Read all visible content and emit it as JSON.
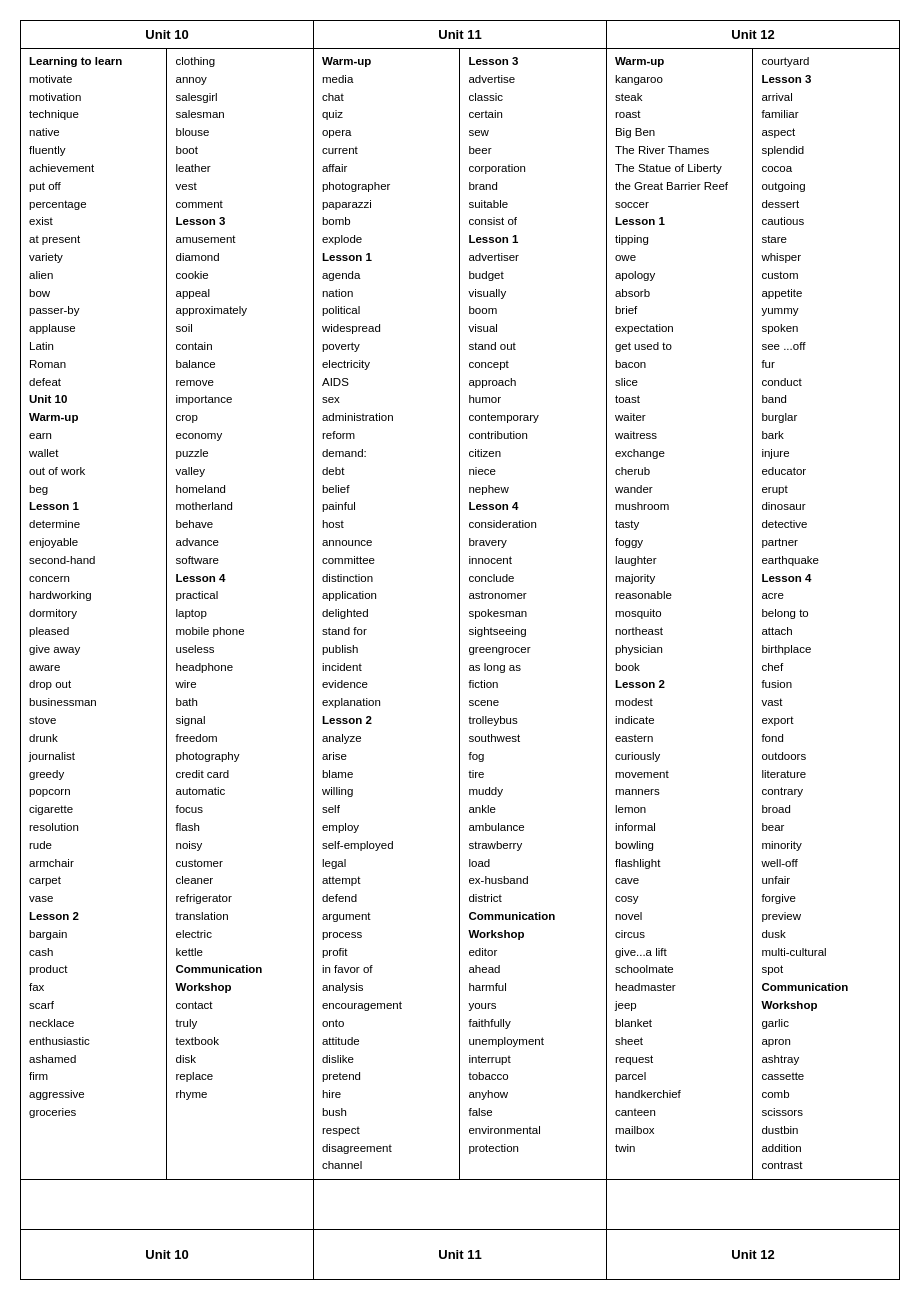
{
  "units": {
    "unit10_header": "Unit 10",
    "unit11_header": "Unit 11",
    "unit12_header": "Unit 12"
  },
  "columns": {
    "col1": [
      {
        "text": "Learning to learn",
        "bold": true
      },
      {
        "text": "motivate"
      },
      {
        "text": "motivation"
      },
      {
        "text": "technique"
      },
      {
        "text": "native"
      },
      {
        "text": "fluently"
      },
      {
        "text": "achievement"
      },
      {
        "text": "put off"
      },
      {
        "text": "percentage"
      },
      {
        "text": "exist"
      },
      {
        "text": "at present"
      },
      {
        "text": "variety"
      },
      {
        "text": "alien"
      },
      {
        "text": "bow"
      },
      {
        "text": "passer-by"
      },
      {
        "text": "applause"
      },
      {
        "text": "Latin"
      },
      {
        "text": "Roman"
      },
      {
        "text": "defeat"
      },
      {
        "text": "Unit 10",
        "bold": true
      },
      {
        "text": "Warm-up",
        "bold": true
      },
      {
        "text": "earn"
      },
      {
        "text": "wallet"
      },
      {
        "text": "out of work"
      },
      {
        "text": "beg"
      },
      {
        "text": "Lesson 1",
        "bold": true
      },
      {
        "text": "determine"
      },
      {
        "text": "enjoyable"
      },
      {
        "text": "second-hand"
      },
      {
        "text": "concern"
      },
      {
        "text": "hardworking"
      },
      {
        "text": "dormitory"
      },
      {
        "text": "pleased"
      },
      {
        "text": "give away"
      },
      {
        "text": "aware"
      },
      {
        "text": "drop out"
      },
      {
        "text": "businessman"
      },
      {
        "text": " stove"
      },
      {
        "text": "drunk"
      },
      {
        "text": "journalist"
      },
      {
        "text": "greedy"
      },
      {
        "text": "popcorn"
      },
      {
        "text": "cigarette"
      },
      {
        "text": "resolution"
      },
      {
        "text": "rude"
      },
      {
        "text": "armchair"
      },
      {
        "text": "carpet"
      },
      {
        "text": "vase"
      },
      {
        "text": "Lesson 2",
        "bold": true
      },
      {
        "text": "bargain"
      },
      {
        "text": "cash"
      },
      {
        "text": "product"
      },
      {
        "text": "fax"
      },
      {
        "text": "scarf"
      },
      {
        "text": "necklace"
      },
      {
        "text": "enthusiastic"
      },
      {
        "text": "ashamed"
      },
      {
        "text": "firm"
      },
      {
        "text": "aggressive"
      },
      {
        "text": "groceries"
      }
    ],
    "col2": [
      {
        "text": "clothing"
      },
      {
        "text": "annoy"
      },
      {
        "text": "salesgirl"
      },
      {
        "text": "salesman"
      },
      {
        "text": "blouse"
      },
      {
        "text": "boot"
      },
      {
        "text": "leather"
      },
      {
        "text": "vest"
      },
      {
        "text": "comment"
      },
      {
        "text": "Lesson 3",
        "bold": true
      },
      {
        "text": "amusement"
      },
      {
        "text": "diamond"
      },
      {
        "text": "cookie"
      },
      {
        "text": "appeal"
      },
      {
        "text": "approximately"
      },
      {
        "text": "soil"
      },
      {
        "text": "contain"
      },
      {
        "text": "balance"
      },
      {
        "text": "remove"
      },
      {
        "text": "importance"
      },
      {
        "text": "crop"
      },
      {
        "text": "economy"
      },
      {
        "text": "puzzle"
      },
      {
        "text": "valley"
      },
      {
        "text": "homeland"
      },
      {
        "text": "motherland"
      },
      {
        "text": "behave"
      },
      {
        "text": "advance"
      },
      {
        "text": "software"
      },
      {
        "text": "Lesson 4",
        "bold": true
      },
      {
        "text": "practical"
      },
      {
        "text": "laptop"
      },
      {
        "text": "mobile phone"
      },
      {
        "text": "useless"
      },
      {
        "text": "headphone"
      },
      {
        "text": "wire"
      },
      {
        "text": "bath"
      },
      {
        "text": "signal"
      },
      {
        "text": "freedom"
      },
      {
        "text": "photography"
      },
      {
        "text": "credit card"
      },
      {
        "text": "automatic"
      },
      {
        "text": "focus"
      },
      {
        "text": "flash"
      },
      {
        "text": "noisy"
      },
      {
        "text": "customer"
      },
      {
        "text": "cleaner"
      },
      {
        "text": "refrigerator"
      },
      {
        "text": "translation"
      },
      {
        "text": "electric"
      },
      {
        "text": "kettle"
      },
      {
        "text": "Communication",
        "bold": true
      },
      {
        "text": "Workshop",
        "bold": true
      },
      {
        "text": "contact"
      },
      {
        "text": "truly"
      },
      {
        "text": "textbook"
      },
      {
        "text": "disk"
      },
      {
        "text": "replace"
      },
      {
        "text": "rhyme"
      }
    ],
    "col3": [
      {
        "text": "Warm-up",
        "bold": true
      },
      {
        "text": "media"
      },
      {
        "text": "chat"
      },
      {
        "text": "quiz"
      },
      {
        "text": "opera"
      },
      {
        "text": "current"
      },
      {
        "text": "affair"
      },
      {
        "text": "photographer"
      },
      {
        "text": "paparazzi"
      },
      {
        "text": "bomb"
      },
      {
        "text": "explode"
      },
      {
        "text": "Lesson 1",
        "bold": true
      },
      {
        "text": "agenda"
      },
      {
        "text": "nation"
      },
      {
        "text": "political"
      },
      {
        "text": "widespread"
      },
      {
        "text": "poverty"
      },
      {
        "text": "electricity"
      },
      {
        "text": "AIDS"
      },
      {
        "text": "sex"
      },
      {
        "text": "administration"
      },
      {
        "text": "reform"
      },
      {
        "text": "demand:"
      },
      {
        "text": "debt"
      },
      {
        "text": "belief"
      },
      {
        "text": "painful"
      },
      {
        "text": "host"
      },
      {
        "text": "announce"
      },
      {
        "text": "committee"
      },
      {
        "text": "distinction"
      },
      {
        "text": "application"
      },
      {
        "text": "delighted"
      },
      {
        "text": "stand for"
      },
      {
        "text": "publish"
      },
      {
        "text": "incident"
      },
      {
        "text": "evidence"
      },
      {
        "text": "explanation"
      },
      {
        "text": "Lesson 2",
        "bold": true
      },
      {
        "text": "analyze"
      },
      {
        "text": "arise"
      },
      {
        "text": "blame"
      },
      {
        "text": "willing"
      },
      {
        "text": "self"
      },
      {
        "text": "employ"
      },
      {
        "text": "self-employed"
      },
      {
        "text": "legal"
      },
      {
        "text": "attempt"
      },
      {
        "text": "defend"
      },
      {
        "text": "argument"
      },
      {
        "text": "process"
      },
      {
        "text": "profit"
      },
      {
        "text": "in favor of"
      },
      {
        "text": "analysis"
      },
      {
        "text": "encouragement"
      },
      {
        "text": "onto"
      },
      {
        "text": "attitude"
      },
      {
        "text": "dislike"
      },
      {
        "text": "pretend"
      },
      {
        "text": "hire"
      },
      {
        "text": "bush"
      },
      {
        "text": "respect"
      },
      {
        "text": "disagreement"
      },
      {
        "text": "channel"
      }
    ],
    "col4": [
      {
        "text": "Lesson 3",
        "bold": true
      },
      {
        "text": "advertise"
      },
      {
        "text": "classic"
      },
      {
        "text": "certain"
      },
      {
        "text": "sew"
      },
      {
        "text": "beer"
      },
      {
        "text": "corporation"
      },
      {
        "text": "brand"
      },
      {
        "text": "suitable"
      },
      {
        "text": "consist of"
      },
      {
        "text": "Lesson 1",
        "bold": true
      },
      {
        "text": "advertiser"
      },
      {
        "text": "budget"
      },
      {
        "text": "visually"
      },
      {
        "text": "boom"
      },
      {
        "text": "visual"
      },
      {
        "text": "stand out"
      },
      {
        "text": "concept"
      },
      {
        "text": "approach"
      },
      {
        "text": "humor"
      },
      {
        "text": "contemporary"
      },
      {
        "text": "contribution"
      },
      {
        "text": "citizen"
      },
      {
        "text": "niece"
      },
      {
        "text": "nephew"
      },
      {
        "text": "Lesson 4",
        "bold": true
      },
      {
        "text": "consideration"
      },
      {
        "text": "bravery"
      },
      {
        "text": "innocent"
      },
      {
        "text": "conclude"
      },
      {
        "text": "astronomer"
      },
      {
        "text": "spokesman"
      },
      {
        "text": "sightseeing"
      },
      {
        "text": "greengrocer"
      },
      {
        "text": "as long as"
      },
      {
        "text": "fiction"
      },
      {
        "text": "scene"
      },
      {
        "text": "trolleybus"
      },
      {
        "text": "southwest"
      },
      {
        "text": "fog"
      },
      {
        "text": "tire"
      },
      {
        "text": "muddy"
      },
      {
        "text": "ankle"
      },
      {
        "text": "ambulance"
      },
      {
        "text": "strawberry"
      },
      {
        "text": "load"
      },
      {
        "text": "ex-husband"
      },
      {
        "text": "district"
      },
      {
        "text": "Communication",
        "bold": true
      },
      {
        "text": "Workshop",
        "bold": true
      },
      {
        "text": "editor"
      },
      {
        "text": "ahead"
      },
      {
        "text": "harmful"
      },
      {
        "text": "yours"
      },
      {
        "text": "faithfully"
      },
      {
        "text": "unemployment"
      },
      {
        "text": "interrupt"
      },
      {
        "text": "tobacco"
      },
      {
        "text": "anyhow"
      },
      {
        "text": "false"
      },
      {
        "text": "environmental"
      },
      {
        "text": "protection"
      }
    ],
    "col5": [
      {
        "text": "Warm-up",
        "bold": true
      },
      {
        "text": "kangaroo"
      },
      {
        "text": "steak"
      },
      {
        "text": "roast"
      },
      {
        "text": "Big Ben"
      },
      {
        "text": "The River Thames"
      },
      {
        "text": "The Statue of Liberty"
      },
      {
        "text": "the Great Barrier Reef"
      },
      {
        "text": "soccer"
      },
      {
        "text": "Lesson 1",
        "bold": true
      },
      {
        "text": "tipping"
      },
      {
        "text": "owe"
      },
      {
        "text": "apology"
      },
      {
        "text": "absorb"
      },
      {
        "text": "brief"
      },
      {
        "text": "expectation"
      },
      {
        "text": "get used to"
      },
      {
        "text": "bacon"
      },
      {
        "text": "slice"
      },
      {
        "text": "toast"
      },
      {
        "text": "waiter"
      },
      {
        "text": "waitress"
      },
      {
        "text": "exchange"
      },
      {
        "text": "cherub"
      },
      {
        "text": "wander"
      },
      {
        "text": "mushroom"
      },
      {
        "text": "tasty"
      },
      {
        "text": "foggy"
      },
      {
        "text": "laughter"
      },
      {
        "text": "majority"
      },
      {
        "text": "reasonable"
      },
      {
        "text": "mosquito"
      },
      {
        "text": "northeast"
      },
      {
        "text": "physician"
      },
      {
        "text": "book"
      },
      {
        "text": "Lesson 2",
        "bold": true
      },
      {
        "text": "modest"
      },
      {
        "text": "indicate"
      },
      {
        "text": "eastern"
      },
      {
        "text": "curiously"
      },
      {
        "text": "movement"
      },
      {
        "text": "manners"
      },
      {
        "text": "lemon"
      },
      {
        "text": "informal"
      },
      {
        "text": "bowling"
      },
      {
        "text": "flashlight"
      },
      {
        "text": "cave"
      },
      {
        "text": "cosy"
      },
      {
        "text": "novel"
      },
      {
        "text": "circus"
      },
      {
        "text": "give...a lift"
      },
      {
        "text": "schoolmate"
      },
      {
        "text": "headmaster"
      },
      {
        "text": "jeep"
      },
      {
        "text": "blanket"
      },
      {
        "text": "sheet"
      },
      {
        "text": "request"
      },
      {
        "text": "parcel"
      },
      {
        "text": "handkerchief"
      },
      {
        "text": "canteen"
      },
      {
        "text": "mailbox"
      },
      {
        "text": "twin"
      }
    ],
    "col6": [
      {
        "text": "courtyard"
      },
      {
        "text": "Lesson 3",
        "bold": true
      },
      {
        "text": "arrival"
      },
      {
        "text": "familiar"
      },
      {
        "text": "aspect"
      },
      {
        "text": "splendid"
      },
      {
        "text": "cocoa"
      },
      {
        "text": "outgoing"
      },
      {
        "text": "dessert"
      },
      {
        "text": "cautious"
      },
      {
        "text": "stare"
      },
      {
        "text": "whisper"
      },
      {
        "text": "custom"
      },
      {
        "text": "appetite"
      },
      {
        "text": "yummy"
      },
      {
        "text": "spoken"
      },
      {
        "text": "see ...off"
      },
      {
        "text": "fur"
      },
      {
        "text": "conduct"
      },
      {
        "text": "band"
      },
      {
        "text": "burglar"
      },
      {
        "text": "bark"
      },
      {
        "text": "injure"
      },
      {
        "text": "educator"
      },
      {
        "text": "erupt"
      },
      {
        "text": "dinosaur"
      },
      {
        "text": "detective"
      },
      {
        "text": "partner"
      },
      {
        "text": "earthquake"
      },
      {
        "text": "Lesson 4",
        "bold": true
      },
      {
        "text": "acre"
      },
      {
        "text": "belong to"
      },
      {
        "text": "attach"
      },
      {
        "text": "birthplace"
      },
      {
        "text": "chef"
      },
      {
        "text": "fusion"
      },
      {
        "text": "vast"
      },
      {
        "text": "export"
      },
      {
        "text": "fond"
      },
      {
        "text": "outdoors"
      },
      {
        "text": "literature"
      },
      {
        "text": "contrary"
      },
      {
        "text": "broad"
      },
      {
        "text": "bear"
      },
      {
        "text": "minority"
      },
      {
        "text": "well-off"
      },
      {
        "text": "unfair"
      },
      {
        "text": "forgive"
      },
      {
        "text": "preview"
      },
      {
        "text": "dusk"
      },
      {
        "text": "multi-cultural"
      },
      {
        "text": "spot"
      },
      {
        "text": "Communication",
        "bold": true
      },
      {
        "text": "Workshop",
        "bold": true
      },
      {
        "text": "garlic"
      },
      {
        "text": "apron"
      },
      {
        "text": "ashtray"
      },
      {
        "text": "cassette"
      },
      {
        "text": "comb"
      },
      {
        "text": "scissors"
      },
      {
        "text": "dustbin"
      },
      {
        "text": "addition"
      },
      {
        "text": "contrast"
      }
    ]
  }
}
